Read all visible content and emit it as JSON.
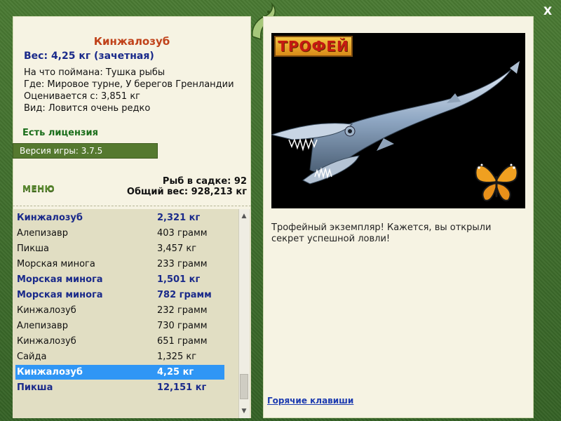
{
  "title": "Кинжалозуб",
  "weight_line": "Вес: 4,25 кг (зачетная)",
  "info": [
    "На что поймана: Тушка рыбы",
    "Где: Мировое турне, У берегов Гренландии",
    "Оценивается с: 3,851 кг",
    "Вид: Ловится очень редко"
  ],
  "license": "Есть лицензия",
  "version": "Версия игры: 3.7.5",
  "menu_label": "МЕНЮ",
  "keep_count": "Рыб в садке: 92",
  "total_weight": "Общий вес: 928,213 кг",
  "fish_list": [
    {
      "name": "Кинжалозуб",
      "weight": "2,321 кг",
      "trophy": true,
      "selected": false
    },
    {
      "name": "Алепизавр",
      "weight": "403 грамм",
      "trophy": false,
      "selected": false
    },
    {
      "name": "Пикша",
      "weight": "3,457 кг",
      "trophy": false,
      "selected": false
    },
    {
      "name": "Морская минога",
      "weight": "233 грамм",
      "trophy": false,
      "selected": false
    },
    {
      "name": "Морская минога",
      "weight": "1,501 кг",
      "trophy": true,
      "selected": false
    },
    {
      "name": "Морская минога",
      "weight": "782 грамм",
      "trophy": true,
      "selected": false
    },
    {
      "name": "Кинжалозуб",
      "weight": "232 грамм",
      "trophy": false,
      "selected": false
    },
    {
      "name": "Алепизавр",
      "weight": "730 грамм",
      "trophy": false,
      "selected": false
    },
    {
      "name": "Кинжалозуб",
      "weight": "651 грамм",
      "trophy": false,
      "selected": false
    },
    {
      "name": "Сайда",
      "weight": "1,325 кг",
      "trophy": false,
      "selected": false
    },
    {
      "name": "Кинжалозуб",
      "weight": "4,25 кг",
      "trophy": false,
      "selected": true
    },
    {
      "name": "Пикша",
      "weight": "12,151 кг",
      "trophy": true,
      "selected": false
    }
  ],
  "trophy_badge": "ТРОФЕЙ",
  "description": "Трофейный экземпляр! Кажется, вы открыли секрет успешной ловли!",
  "hotkeys": "Горячие клавиши",
  "close_label": "X",
  "icons": {
    "close": "close-icon",
    "logo": "fish-logo-icon",
    "butterfly": "butterfly-icon",
    "scroll_up": "chevron-up-icon",
    "scroll_down": "chevron-down-icon"
  },
  "colors": {
    "frame_green": "#3c6a2a",
    "panel_bg": "#f6f3e3",
    "title_orange": "#c0421a",
    "trophy_blue": "#1a2a8a",
    "selected_blue": "#2f96f5",
    "license_green": "#1b6e1b"
  }
}
